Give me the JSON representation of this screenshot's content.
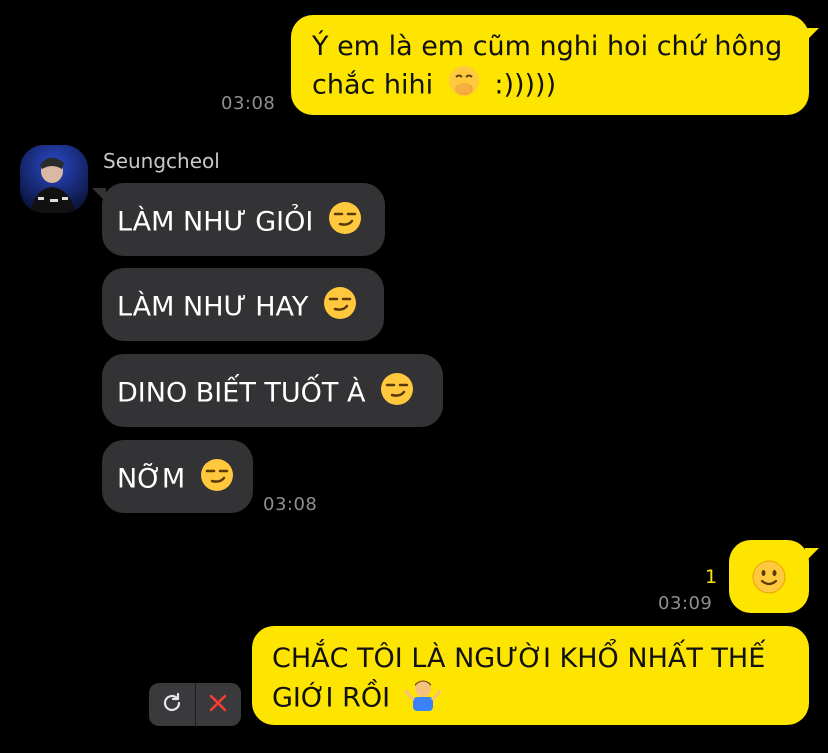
{
  "conversation": {
    "messages": [
      {
        "id": "m1",
        "from": "me",
        "lines": [
          "Ý em là em cũm nghi hoi chứ hông",
          "chắc hihi"
        ],
        "tail_text": ":)))))",
        "emoji": "face-hand-over-mouth",
        "time": "03:08"
      },
      {
        "id": "m2",
        "from": "them",
        "sender": "Seungcheol",
        "text": "LÀM NHƯ GIỎI",
        "emoji": "smirk"
      },
      {
        "id": "m3",
        "from": "them",
        "text": "LÀM NHƯ HAY",
        "emoji": "smirk"
      },
      {
        "id": "m4",
        "from": "them",
        "text": "DINO BIẾT TUỐT À",
        "emoji": "smirk"
      },
      {
        "id": "m5",
        "from": "them",
        "text": "NỠM",
        "emoji": "smirk",
        "time": "03:08"
      },
      {
        "id": "m6",
        "from": "me",
        "emoji": "slightly-smiling-face",
        "unread_count": "1",
        "time": "03:09"
      },
      {
        "id": "m7",
        "from": "me",
        "lines": [
          "CHẮC TÔI LÀ NGƯỜI KHỔ NHẤT THẾ",
          "GIỚI RỒI"
        ],
        "emoji": "person-shrugging",
        "status": "failed"
      }
    ]
  },
  "colors": {
    "background": "#000000",
    "my_bubble": "#fee500",
    "their_bubble": "#333335",
    "timestamp": "#8e8e93",
    "unread": "#fee500"
  },
  "icons": {
    "retry": "refresh-icon",
    "delete": "close-icon"
  }
}
